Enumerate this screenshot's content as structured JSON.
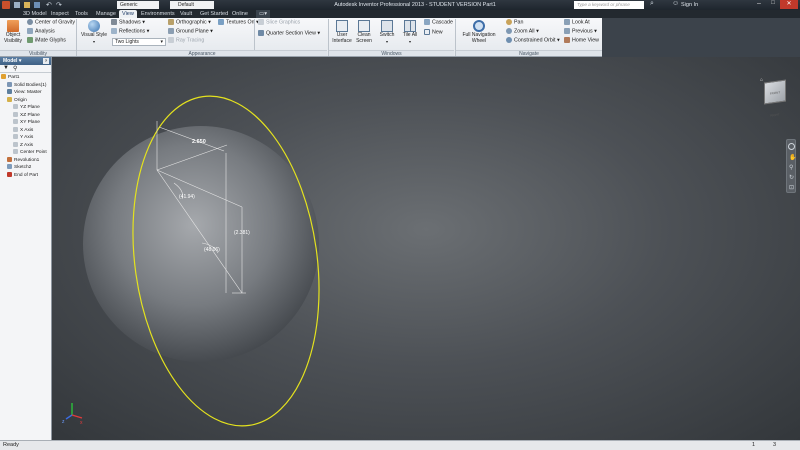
{
  "window": {
    "title": "Autodesk Inventor Professional 2013 - STUDENT VERSION    Part1",
    "search_placeholder": "Type a keyword or phrase",
    "sign_in": "Sign In"
  },
  "quick_access": {
    "material": "Generic",
    "appearance": "Default"
  },
  "tabs": [
    "3D Model",
    "Inspect",
    "Tools",
    "Manage",
    "View",
    "Environments",
    "Vault",
    "Get Started",
    "Online"
  ],
  "active_tab": "View",
  "ribbon": {
    "visibility": {
      "object_visibility": "Object\nVisibility",
      "center_of_gravity": "Center of Gravity",
      "analysis": "Analysis",
      "ifeature_glyphs": "iMate Glyphs",
      "label": "Visibility"
    },
    "appearance": {
      "visual_style": "Visual Style",
      "shadows": "Shadows",
      "reflections": "Reflections",
      "lighting": "Two Lights",
      "orthographic": "Orthographic",
      "ground_plane": "Ground Plane",
      "ray_tracing": "Ray Tracing",
      "textures_on": "Textures On",
      "slice_graphics": "Slice Graphics",
      "quarter_section": "Quarter Section View",
      "label": "Appearance"
    },
    "windows": {
      "user_interface": "User\nInterface",
      "clean_screen": "Clean\nScreen",
      "switch": "Switch",
      "tile_all": "Tile All",
      "cascade": "Cascade",
      "new": "New",
      "label": "Windows"
    },
    "navigate": {
      "full_nav_wheel": "Full Navigation\nWheel",
      "pan": "Pan",
      "zoom_all": "Zoom All",
      "constrained_orbit": "Constrained Orbit",
      "look_at": "Look At",
      "previous": "Previous",
      "home_view": "Home View",
      "label": "Navigate"
    }
  },
  "browser": {
    "header": "Model",
    "tree": [
      {
        "label": "Part1",
        "indent": 0
      },
      {
        "label": "Solid Bodies(1)",
        "indent": 1
      },
      {
        "label": "View: Master",
        "indent": 1
      },
      {
        "label": "Origin",
        "indent": 1
      },
      {
        "label": "YZ Plane",
        "indent": 2
      },
      {
        "label": "XZ Plane",
        "indent": 2
      },
      {
        "label": "XY Plane",
        "indent": 2
      },
      {
        "label": "X Axis",
        "indent": 2
      },
      {
        "label": "Y Axis",
        "indent": 2
      },
      {
        "label": "Z Axis",
        "indent": 2
      },
      {
        "label": "Center Point",
        "indent": 2
      },
      {
        "label": "Revolution1",
        "indent": 1
      },
      {
        "label": "Sketch2",
        "indent": 1
      },
      {
        "label": "End of Part",
        "indent": 1
      }
    ]
  },
  "viewport": {
    "dimensions": [
      "2.650",
      "(41.94)",
      "(2.381)",
      "(48.06)"
    ],
    "viewcube": "FRONT  RIGHT"
  },
  "status": {
    "text": "Ready",
    "count1": "1",
    "count2": "3"
  }
}
